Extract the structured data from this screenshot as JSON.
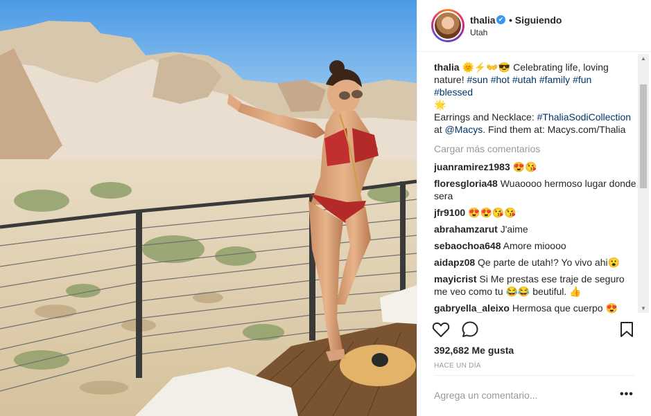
{
  "header": {
    "username": "thalia",
    "verified_icon": "✔",
    "follow_status": "• Siguiendo",
    "location": "Utah"
  },
  "caption": {
    "username": "thalia",
    "emojis": "🌞⚡👐😎",
    "text_1": "Celebrating life, loving nature!",
    "tags": [
      "#sun",
      "#hot",
      "#utah",
      "#family",
      "#fun",
      "#blessed"
    ],
    "emoji_2": "🌟",
    "text_2": "Earrings and Necklace:",
    "collection_tag": "#ThaliaSodiCollection",
    "text_3": "at",
    "mention": "@Macys",
    "text_4": ". Find them at: Macys.com/Thalia"
  },
  "load_more": "Cargar más comentarios",
  "comments": [
    {
      "user": "juanramirez1983",
      "text": "😍😘"
    },
    {
      "user": "floresgloria48",
      "text": "Wuaoooo hermoso lugar donde sera"
    },
    {
      "user": "jfr9100",
      "text": "😍😍😘😘"
    },
    {
      "user": "abrahamzarut",
      "text": "J'aime"
    },
    {
      "user": "sebaochoa648",
      "text": "Amore mioooo"
    },
    {
      "user": "aidapz08",
      "text": "Qe parte de utah!? Yo vivo ahi😮"
    },
    {
      "user": "mayicrist",
      "text": "Si Me prestas ese traje de seguro me veo como tu 😂😂 beutiful. 👍"
    },
    {
      "user": "gabryella_aleixo",
      "text": "Hermosa que cuerpo 😍"
    }
  ],
  "likes": "392,682 Me gusta",
  "timestamp": "HACE UN DÍA",
  "comment_placeholder": "Agrega un comentario...",
  "more_options": "•••",
  "scroll_up": "▲",
  "scroll_down": "▼",
  "colors": {
    "hashtag": "#003569",
    "verified": "#3897f0",
    "sky": "#6eaee8",
    "rock": "#d9cbb3"
  }
}
